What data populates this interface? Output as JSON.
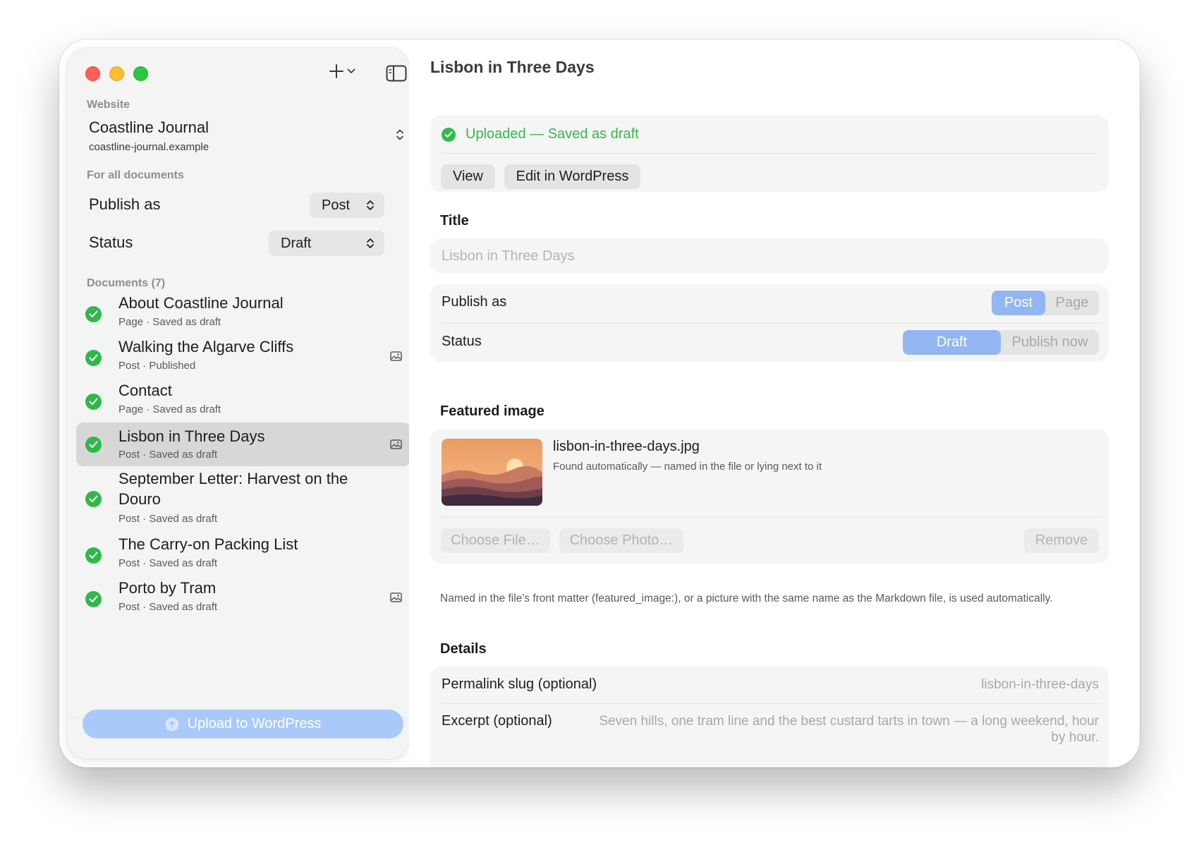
{
  "sidebar": {
    "website_label": "Website",
    "site_name": "Coastline Journal",
    "site_url": "coastline-journal.example",
    "for_all_label": "For all documents",
    "publish_as_label": "Publish as",
    "publish_as_value": "Post",
    "status_label": "Status",
    "status_value": "Draft",
    "documents_label": "Documents (7)",
    "documents": [
      {
        "title": "About Coastline Journal",
        "subtitle": "Page · Saved as draft",
        "has_image": false,
        "selected": false
      },
      {
        "title": "Walking the Algarve Cliffs",
        "subtitle": "Post · Published",
        "has_image": true,
        "selected": false
      },
      {
        "title": "Contact",
        "subtitle": "Page · Saved as draft",
        "has_image": false,
        "selected": false
      },
      {
        "title": "Lisbon in Three Days",
        "subtitle": "Post · Saved as draft",
        "has_image": true,
        "selected": true
      },
      {
        "title": "September Letter: Harvest on the Douro",
        "subtitle": "Post · Saved as draft",
        "has_image": false,
        "selected": false
      },
      {
        "title": "The Carry-on Packing List",
        "subtitle": "Post · Saved as draft",
        "has_image": false,
        "selected": false
      },
      {
        "title": "Porto by Tram",
        "subtitle": "Post · Saved as draft",
        "has_image": true,
        "selected": false
      }
    ],
    "upload_button": "Upload to WordPress"
  },
  "main": {
    "title": "Lisbon in Three Days",
    "status_text": "Uploaded — Saved as draft",
    "view_button": "View",
    "edit_button": "Edit in WordPress",
    "title_section": "Title",
    "title_placeholder": "Lisbon in Three Days",
    "publish_as_label": "Publish as",
    "publish_options": [
      "Post",
      "Page"
    ],
    "publish_selected": "Post",
    "status_label": "Status",
    "status_options": [
      "Draft",
      "Publish now"
    ],
    "status_selected": "Draft",
    "featured_section": "Featured image",
    "file_name": "lisbon-in-three-days.jpg",
    "file_sub": "Found automatically — named in the file or lying next to it",
    "choose_file": "Choose File…",
    "choose_photo": "Choose Photo…",
    "remove": "Remove",
    "help_text": "Named in the file's front matter (featured_image:), or a picture with the same name as the Markdown file, is used automatically.",
    "details_section": "Details",
    "permalink_label": "Permalink slug (optional)",
    "permalink_placeholder": "lisbon-in-three-days",
    "excerpt_label": "Excerpt (optional)",
    "excerpt_placeholder": "Seven hills, one tram line and the best custard tarts in town — a long weekend, hour by hour."
  },
  "colors": {
    "accent": "#93b6f2",
    "success": "#34b84f",
    "upload_button": "#a9c9fb"
  },
  "icons": {
    "add": "plus-icon",
    "sidebar_toggle": "sidebar-toggle-icon",
    "status": "checkmark-circle-icon",
    "image": "photo-icon"
  }
}
